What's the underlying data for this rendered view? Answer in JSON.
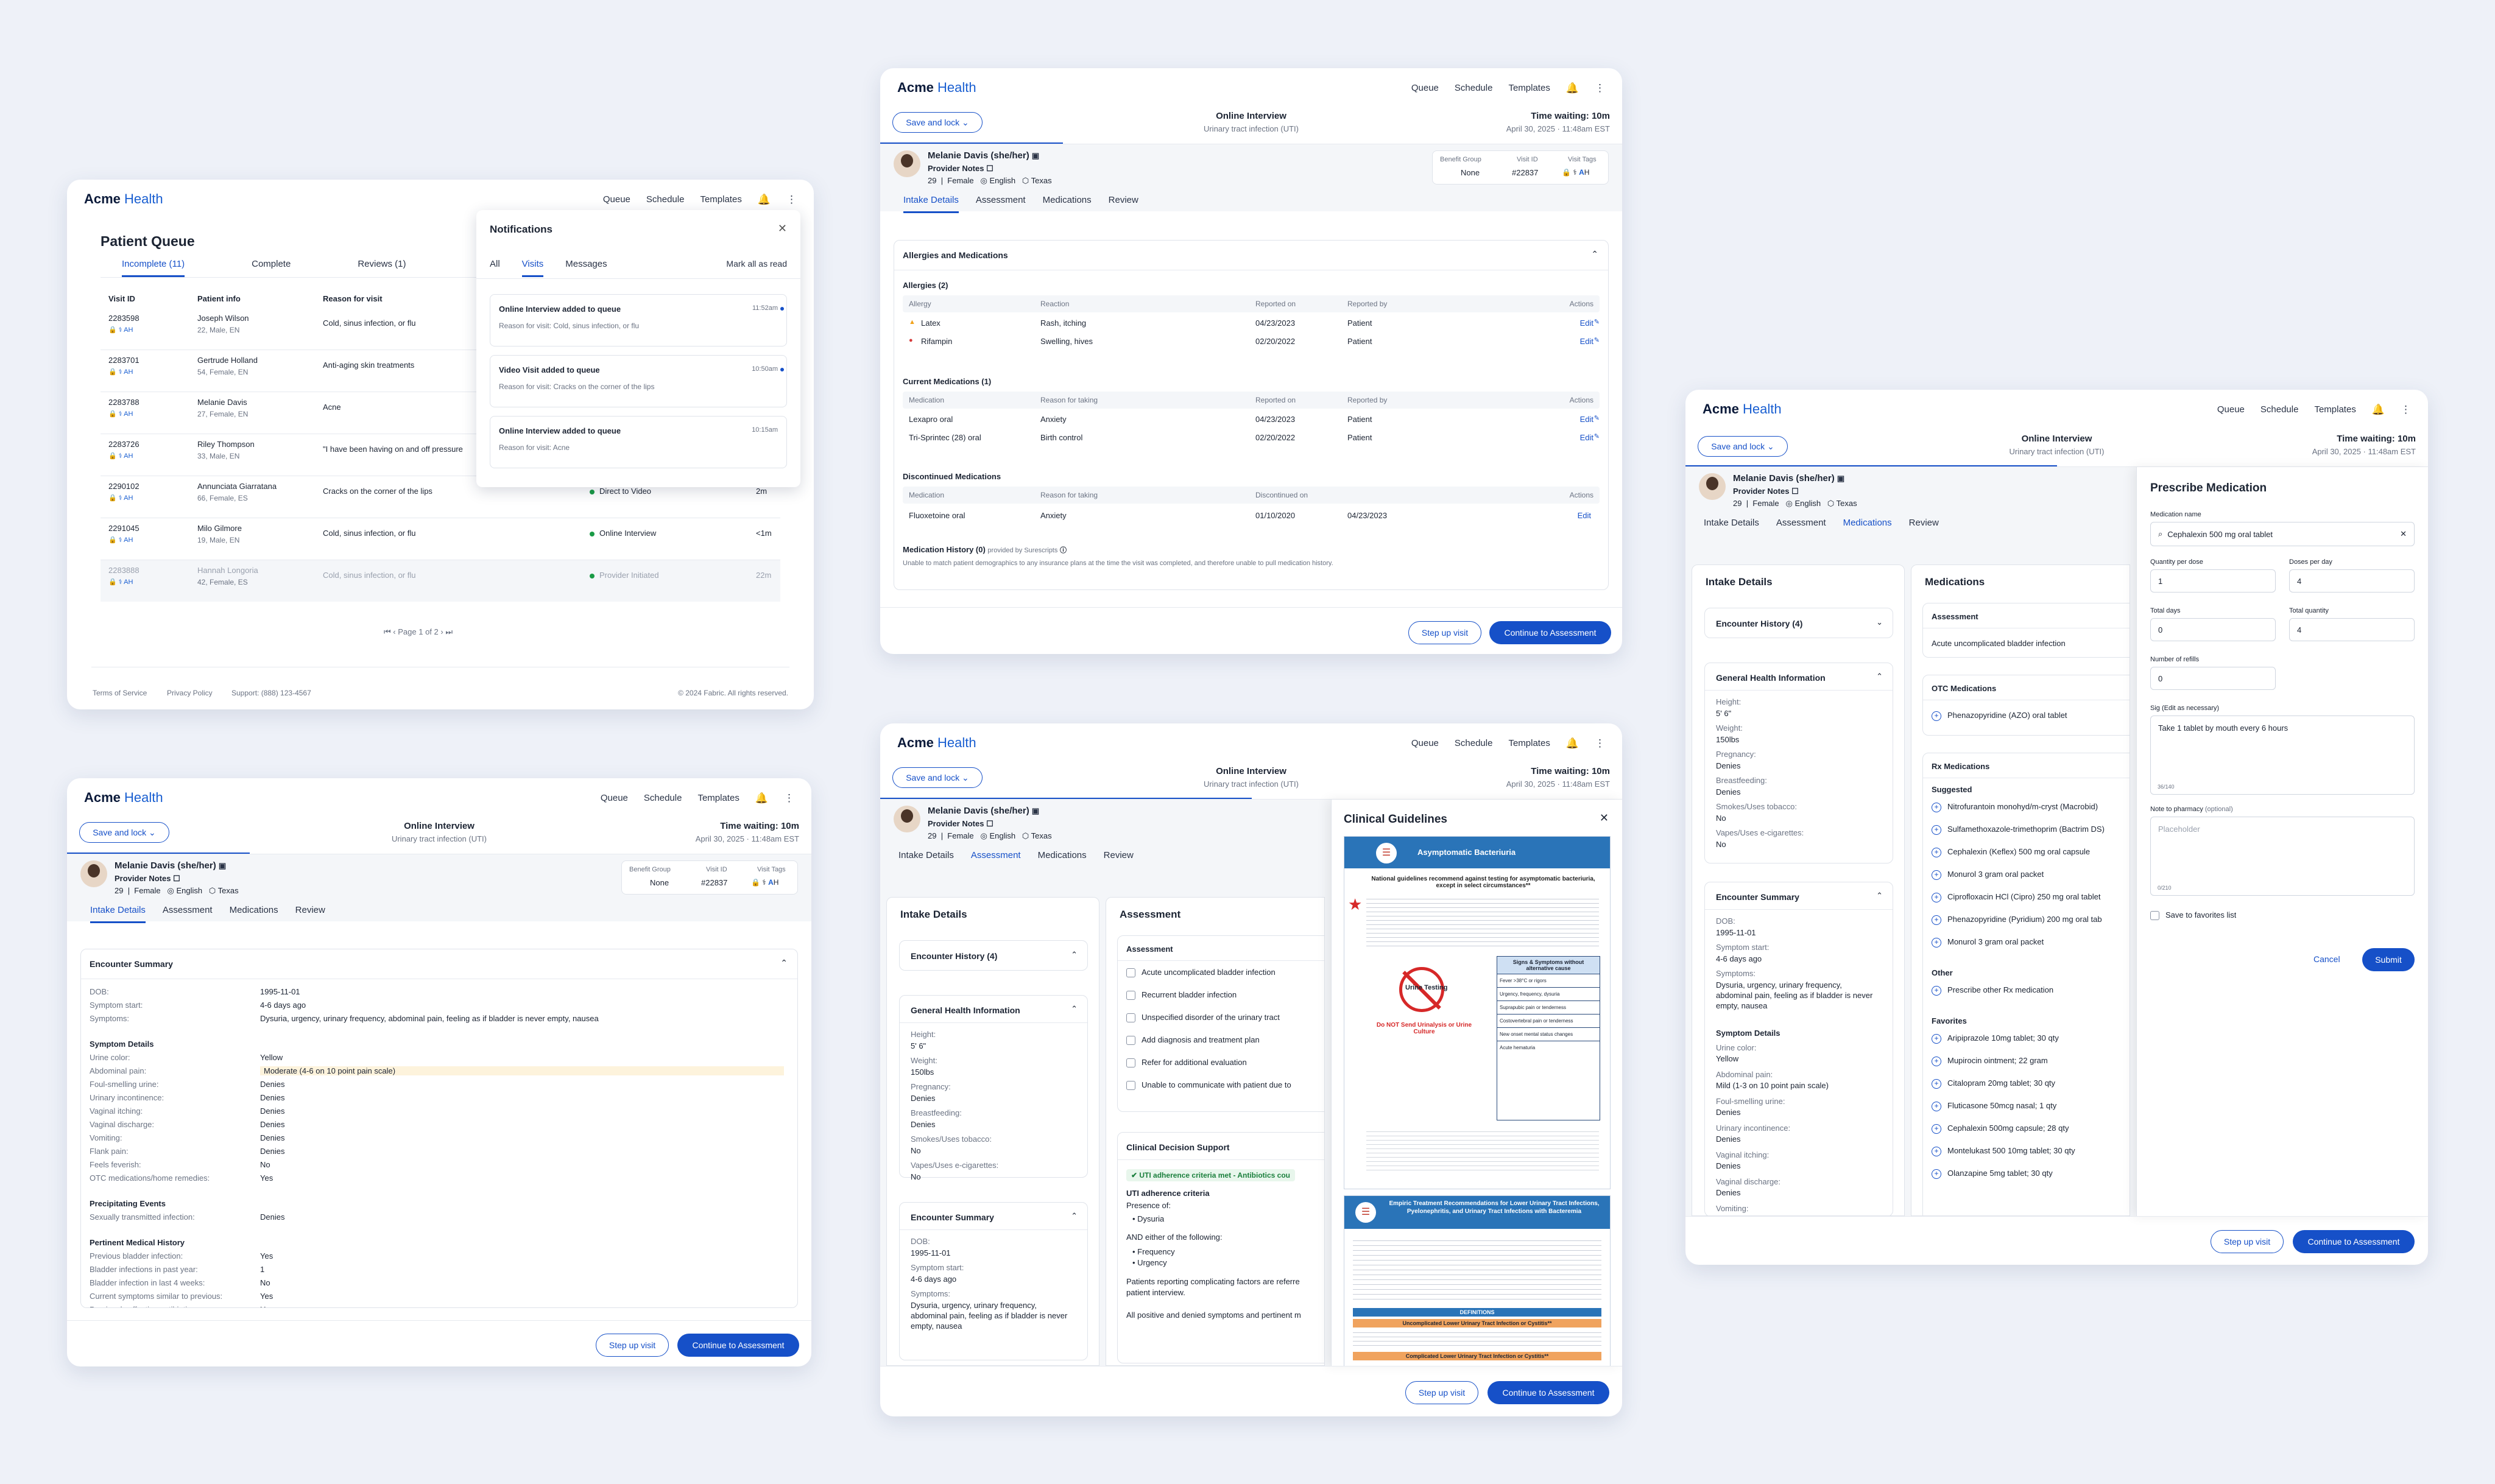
{
  "brand": {
    "name_bold": "Acme",
    "name_light": "Health"
  },
  "nav": [
    "Queue",
    "Schedule",
    "Templates"
  ],
  "queue": {
    "title": "Patient Queue",
    "tabs": [
      "Incomplete (11)",
      "Complete",
      "Reviews (1)"
    ],
    "cols": [
      "Visit ID",
      "Patient info",
      "Reason for visit"
    ],
    "rows": [
      {
        "id": "2283598",
        "name": "Joseph Wilson",
        "info": "22, Male, EN",
        "reason": "Cold, sinus infection, or flu",
        "type": "",
        "time": ""
      },
      {
        "id": "2283701",
        "name": "Gertrude Holland",
        "info": "54, Female, EN",
        "reason": "Anti-aging skin treatments",
        "type": "",
        "time": ""
      },
      {
        "id": "2283788",
        "name": "Melanie Davis",
        "info": "27, Female, EN",
        "reason": "Acne",
        "type": "",
        "time": ""
      },
      {
        "id": "2283726",
        "name": "Riley Thompson",
        "info": "33, Male, EN",
        "reason": "\"I have been having on and off pressure",
        "type": "",
        "time": ""
      },
      {
        "id": "2290102",
        "name": "Annunciata Giarratana",
        "info": "66, Female, ES",
        "reason": "Cracks on the corner of the lips",
        "type": "Direct to Video",
        "time": "2m"
      },
      {
        "id": "2291045",
        "name": "Milo Gilmore",
        "info": "19, Male, EN",
        "reason": "Cold, sinus infection, or flu",
        "type": "Online Interview",
        "time": "<1m"
      },
      {
        "id": "2283888",
        "name": "Hannah Longoria",
        "info": "42, Female, ES",
        "reason": "Cold, sinus infection, or flu",
        "type": "Provider Initiated",
        "time": "22m"
      }
    ],
    "pagination": "Page 1 of 2",
    "footer": {
      "terms": "Terms of Service",
      "privacy": "Privacy Policy",
      "support": "Support: (888) 123-4567",
      "copyright": "© 2024 Fabric. All rights reserved."
    }
  },
  "notifications": {
    "title": "Notifications",
    "tabs": [
      "All",
      "Visits",
      "Messages"
    ],
    "mark_read": "Mark all as read",
    "items": [
      {
        "title": "Online Interview added to queue",
        "sub": "Reason for visit: Cold, sinus infection, or flu",
        "time": "11:52am"
      },
      {
        "title": "Video Visit added to queue",
        "sub": "Reason for visit: Cracks on the corner of the lips",
        "time": "10:50am"
      },
      {
        "title": "Online Interview added to queue",
        "sub": "Reason for visit: Acne",
        "time": "10:15am"
      }
    ]
  },
  "visit": {
    "save_lock": "Save and lock",
    "visit_type": "Online Interview",
    "visit_reason": "Urinary tract infection (UTI)",
    "waiting": "Time waiting: 10m",
    "date": "April 30, 2025 · 11:48am EST",
    "patient": "Melanie Davis (she/her)",
    "provider_notes": "Provider Notes",
    "age": "29",
    "sex": "Female",
    "lang": "English",
    "state": "Texas",
    "benefit_label": "Benefit Group",
    "benefit": "None",
    "visitid_label": "Visit ID",
    "visitid": "#22837",
    "tags_label": "Visit Tags",
    "tabs": [
      "Intake Details",
      "Assessment",
      "Medications",
      "Review"
    ],
    "step_up": "Step up visit",
    "continue": "Continue to Assessment"
  },
  "allergies": {
    "section": "Allergies and Medications",
    "allergies_title": "Allergies (2)",
    "allergy_cols": [
      "Allergy",
      "Reaction",
      "Reported on",
      "Reported by",
      "Actions"
    ],
    "allergy_rows": [
      [
        "Latex",
        "Rash, itching",
        "04/23/2023",
        "Patient",
        "Edit"
      ],
      [
        "Rifampin",
        "Swelling, hives",
        "02/20/2022",
        "Patient",
        "Edit"
      ]
    ],
    "current_title": "Current Medications (1)",
    "med_cols": [
      "Medication",
      "Reason for taking",
      "Reported on",
      "Reported by",
      "Actions"
    ],
    "med_rows": [
      [
        "Lexapro oral",
        "Anxiety",
        "04/23/2023",
        "Patient",
        "Edit"
      ],
      [
        "Tri-Sprintec (28) oral",
        "Birth control",
        "02/20/2022",
        "Patient",
        "Edit"
      ]
    ],
    "disc_title": "Discontinued Medications",
    "disc_cols": [
      "Medication",
      "Reason for taking",
      "Discontinued on",
      "Actions"
    ],
    "disc_rows": [
      [
        "Fluoxetoine oral",
        "Anxiety",
        "01/10/2020",
        "04/23/2023",
        "Edit"
      ]
    ],
    "history_title": "Medication History (0)",
    "history_by": "provided by Surescripts",
    "history_note": "Unable to match patient demographics to any insurance plans at the time the visit was completed, and therefore unable to pull medication history."
  },
  "encounter": {
    "title": "Encounter Summary",
    "basic": [
      [
        "DOB:",
        "1995-11-01"
      ],
      [
        "Symptom start:",
        "4-6 days ago"
      ],
      [
        "Symptoms:",
        "Dysuria, urgency, urinary frequency, abdominal pain, feeling as if bladder is never empty, nausea"
      ]
    ],
    "symptom_title": "Symptom Details",
    "symptoms": [
      [
        "Urine color:",
        "Yellow"
      ],
      [
        "Abdominal pain:",
        "Moderate (4-6 on 10 point pain scale)"
      ],
      [
        "Foul-smelling urine:",
        "Denies"
      ],
      [
        "Urinary incontinence:",
        "Denies"
      ],
      [
        "Vaginal itching:",
        "Denies"
      ],
      [
        "Vaginal discharge:",
        "Denies"
      ],
      [
        "Vomiting:",
        "Denies"
      ],
      [
        "Flank pain:",
        "Denies"
      ],
      [
        "Feels feverish:",
        "No"
      ],
      [
        "OTC medications/home remedies:",
        "Yes"
      ]
    ],
    "precip_title": "Precipitating Events",
    "precip": [
      [
        "Sexually transmitted infection:",
        "Denies"
      ]
    ],
    "history_title": "Pertinent Medical History",
    "history": [
      [
        "Previous bladder infection:",
        "Yes"
      ],
      [
        "Bladder infections in past year:",
        "1"
      ],
      [
        "Bladder infection in last 4 weeks:",
        "No"
      ],
      [
        "Current symptoms similar to previous:",
        "Yes"
      ],
      [
        "Previously effective antibiotics:",
        "Unsure"
      ]
    ]
  },
  "intake": {
    "title": "Intake Details",
    "encounter_history": "Encounter History (4)",
    "general_title": "General Health Information",
    "general": [
      [
        "Height:",
        "5' 6\""
      ],
      [
        "Weight:",
        "150lbs"
      ],
      [
        "Pregnancy:",
        "Denies"
      ],
      [
        "Breastfeeding:",
        "Denies"
      ],
      [
        "Smokes/Uses tobacco:",
        "No"
      ],
      [
        "Vapes/Uses e-cigarettes:",
        "No"
      ]
    ],
    "encounter_summary": "Encounter Summary",
    "enc": [
      [
        "DOB:",
        "1995-11-01"
      ],
      [
        "Symptom start:",
        "4-6 days ago"
      ],
      [
        "Symptoms:",
        "Dysuria, urgency, urinary frequency, abdominal pain, feeling as if bladder is never empty, nausea"
      ]
    ],
    "enc_more": [
      [
        "Symptom Details",
        ""
      ],
      [
        "Urine color:",
        "Yellow"
      ],
      [
        "Abdominal pain:",
        "Mild (1-3 on 10 point pain scale)"
      ],
      [
        "Foul-smelling urine:",
        "Denies"
      ],
      [
        "Urinary incontinence:",
        "Denies"
      ],
      [
        "Vaginal itching:",
        "Denies"
      ],
      [
        "Vaginal discharge:",
        "Denies"
      ],
      [
        "Vomiting:",
        "Denies"
      ]
    ]
  },
  "assessment": {
    "title": "Assessment",
    "sub": "Assessment",
    "items": [
      "Acute uncomplicated bladder infection",
      "Recurrent bladder infection",
      "Unspecified disorder of the urinary tract",
      "Add diagnosis and treatment plan",
      "Refer for additional evaluation",
      "Unable to communicate with patient due to"
    ],
    "cds_title": "Clinical Decision Support",
    "cds_badge": "UTI adherence criteria met - Antibiotics cou",
    "criteria_title": "UTI adherence criteria",
    "presence": "Presence of:",
    "presence_items": [
      "Dysuria"
    ],
    "either": "AND either of the following:",
    "either_items": [
      "Frequency",
      "Urgency"
    ],
    "note1": "Patients reporting complicating factors are referre patient interview.",
    "note2": "All positive and denied symptoms and pertinent m"
  },
  "guidelines": {
    "title": "Clinical Guidelines",
    "doc1_title": "Asymptomatic Bacteriuria",
    "doc1_head": "National guidelines recommend against testing for asymptomatic bacteriuria, except in select circumstances**",
    "doc1_box": "Signs & Symptoms without alternative cause",
    "doc1_list": [
      "Fever >38°C or rigors",
      "Urgency, frequency, dysuria",
      "Suprapubic pain or tenderness",
      "Costovertebral pain or tenderness",
      "New onset mental status changes",
      "Acute hematuria"
    ],
    "doc1_stop": "Urine Testing",
    "doc1_stop_note": "Do NOT Send Urinalysis or Urine Culture",
    "doc2_title": "Empiric Treatment Recommendations for Lower Urinary Tract Infections, Pyelonephritis, and Urinary Tract Infections with Bacteremia",
    "doc2_def": "DEFINITIONS",
    "doc2_uncomp": "Uncomplicated Lower Urinary Tract Infection or Cystitis**",
    "doc2_comp": "Complicated Lower Urinary Tract Infection or Cystitis**"
  },
  "meds": {
    "title": "Medications",
    "assessment": "Assessment",
    "assessment_value": "Acute uncomplicated bladder infection",
    "otc_title": "OTC Medications",
    "otc": [
      "Phenazopyridine (AZO) oral tablet"
    ],
    "rx_title": "Rx Medications",
    "suggested": "Suggested",
    "rx": [
      "Nitrofurantoin monohyd/m-cryst (Macrobid)",
      "Sulfamethoxazole-trimethoprim (Bactrim DS)",
      "Cephalexin (Keflex) 500 mg oral capsule",
      "Monurol 3 gram oral packet",
      "Ciprofloxacin HCl (Cipro) 250 mg oral tablet",
      "Phenazopyridine (Pyridium) 200 mg oral tab",
      "Monurol 3 gram oral packet"
    ],
    "other": "Other",
    "other_items": [
      "Prescribe other Rx medication"
    ],
    "favorites": "Favorites",
    "fav": [
      "Aripiprazole 10mg tablet; 30 qty",
      "Mupirocin ointment; 22 gram",
      "Citalopram 20mg tablet; 30 qty",
      "Fluticasone 50mcg nasal; 1 qty",
      "Cephalexin 500mg capsule; 28 qty",
      "Montelukast 500 10mg tablet; 30 qty",
      "Olanzapine 5mg tablet; 30 qty"
    ]
  },
  "prescribe": {
    "title": "Prescribe Medication",
    "name_label": "Medication name",
    "name_value": "Cephalexin 500 mg oral tablet",
    "qty_label": "Quantity per dose",
    "qty": "1",
    "doses_label": "Doses per day",
    "doses": "4",
    "days_label": "Total days",
    "days": "0",
    "total_label": "Total quantity",
    "total": "4",
    "refills_label": "Number of refills",
    "refills": "0",
    "sig_label": "Sig (Edit as necessary)",
    "sig": "Take 1 tablet by mouth every 6 hours",
    "sig_count": "36/140",
    "pharm_label": "Note to pharmacy",
    "pharm_opt": "(optional)",
    "pharm_placeholder": "Placeholder",
    "pharm_count": "0/210",
    "favorite": "Save to favorites list",
    "cancel": "Cancel",
    "submit": "Submit"
  },
  "colors": {
    "primary": "#1650c8",
    "brand": "#1a5fd1",
    "success": "#1a9b46",
    "warning": "#f1a21b",
    "danger": "#d63a3a"
  }
}
